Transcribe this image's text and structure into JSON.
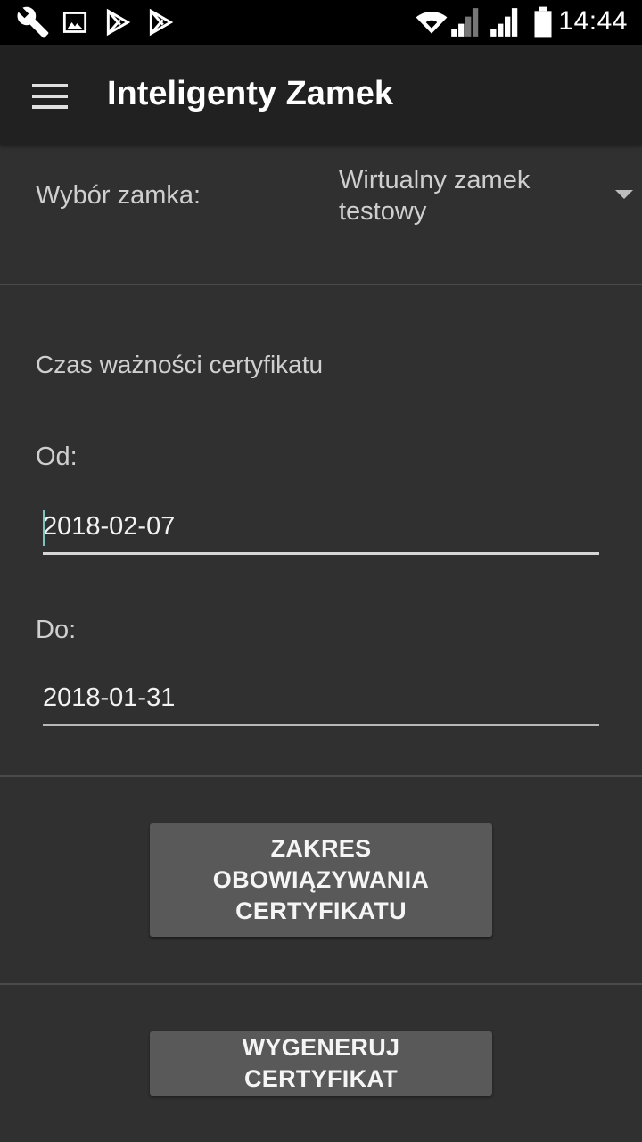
{
  "status_bar": {
    "time": "14:44",
    "icons": [
      "wrench-icon",
      "image-icon",
      "play-store-icon",
      "play-store-icon",
      "wifi-icon",
      "signal-icon",
      "signal-icon",
      "battery-icon"
    ]
  },
  "app_bar": {
    "title": "Inteligenty Zamek",
    "menu_icon": "hamburger-menu-icon"
  },
  "lock_selection": {
    "label": "Wybór zamka:",
    "selected_value": "Wirtualny zamek testowy"
  },
  "certificate_validity": {
    "title": "Czas ważności certyfikatu",
    "from_label": "Od:",
    "from_value": "2018-02-07",
    "to_label": "Do:",
    "to_value": "2018-01-31"
  },
  "buttons": {
    "validity_range": "ZAKRES OBOWIĄZYWANIA CERTYFIKATU",
    "generate": "WYGENERUJ CERTYFIKAT"
  },
  "colors": {
    "background": "#303030",
    "app_bar": "#212121",
    "button": "#595959",
    "cursor_accent": "#7fc3c1"
  }
}
